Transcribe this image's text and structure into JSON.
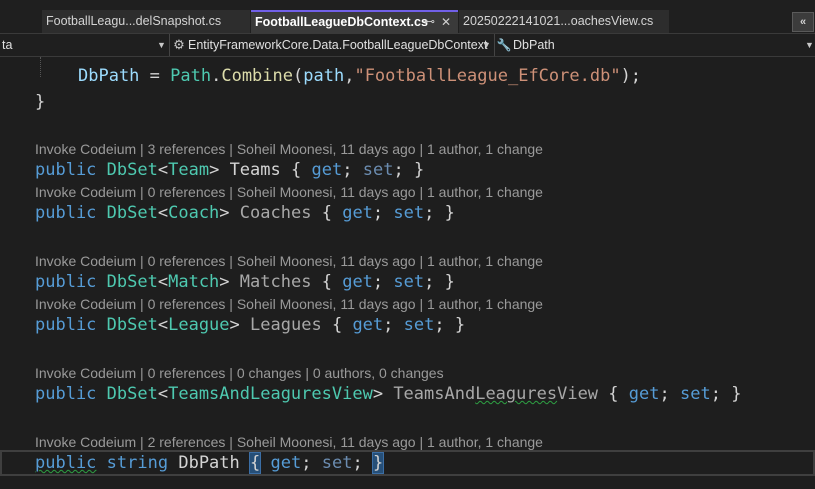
{
  "tabs": [
    {
      "label": "FootballLeagu...delSnapshot.cs"
    },
    {
      "label": "FootballLeagueDbContext.cs",
      "active": true,
      "pin": "⊷",
      "close": "✕"
    },
    {
      "label": "20250222141021...oachesView.cs"
    }
  ],
  "tab_menu_label": "«",
  "nav": {
    "project": "ta",
    "namespace": "EntityFrameworkCore.Data.FootballLeagueDbContext",
    "member": "DbPath"
  },
  "lens": [
    {
      "text": "Invoke Codeium | 3 references | Soheil Moonesi, 11 days ago | 1 author, 1 change"
    },
    {
      "text": "Invoke Codeium | 0 references | Soheil Moonesi, 11 days ago | 1 author, 1 change"
    },
    {
      "text": "Invoke Codeium | 0 references | Soheil Moonesi, 11 days ago | 1 author, 1 change"
    },
    {
      "text": "Invoke Codeium | 0 references | Soheil Moonesi, 11 days ago | 1 author, 1 change"
    },
    {
      "text": "Invoke Codeium | 0 references | 0 changes | 0 authors, 0 changes"
    },
    {
      "text": "Invoke Codeium | 2 references | Soheil Moonesi, 11 days ago | 1 author, 1 change"
    }
  ],
  "code": {
    "dbpath_assign": {
      "var": "DbPath",
      "eq": " = ",
      "cls": "Path",
      "dot": ".",
      "method": "Combine",
      "open": "(",
      "arg": "path",
      "comma": ",",
      "str": "\"FootballLeague_EfCore.db\"",
      "close": ");"
    },
    "brace_close": "}",
    "props": [
      {
        "type": "Team",
        "name": "Teams"
      },
      {
        "type": "Coach",
        "name": "Coaches"
      },
      {
        "type": "Match",
        "name": "Matches"
      },
      {
        "type": "League",
        "name": "Leagues"
      },
      {
        "type": "TeamsAndLeaguresView",
        "name_a": "TeamsAnd",
        "name_b": "Leagures",
        "name_c": "View"
      }
    ],
    "kw_public": "public",
    "kw_string": "string",
    "dbset": "DbSet",
    "lt": "<",
    "gt": ">",
    "get": "get",
    "set": "set",
    "semi": ";",
    "ob": "{",
    "cb": "}",
    "last_name": "DbPath"
  },
  "colors": {
    "keyword": "#569cd6",
    "type": "#4ec9b0",
    "string": "#ce9178",
    "method": "#dcdcaa",
    "variable": "#9cdcfe",
    "active_tab_accent": "#7160e8"
  }
}
